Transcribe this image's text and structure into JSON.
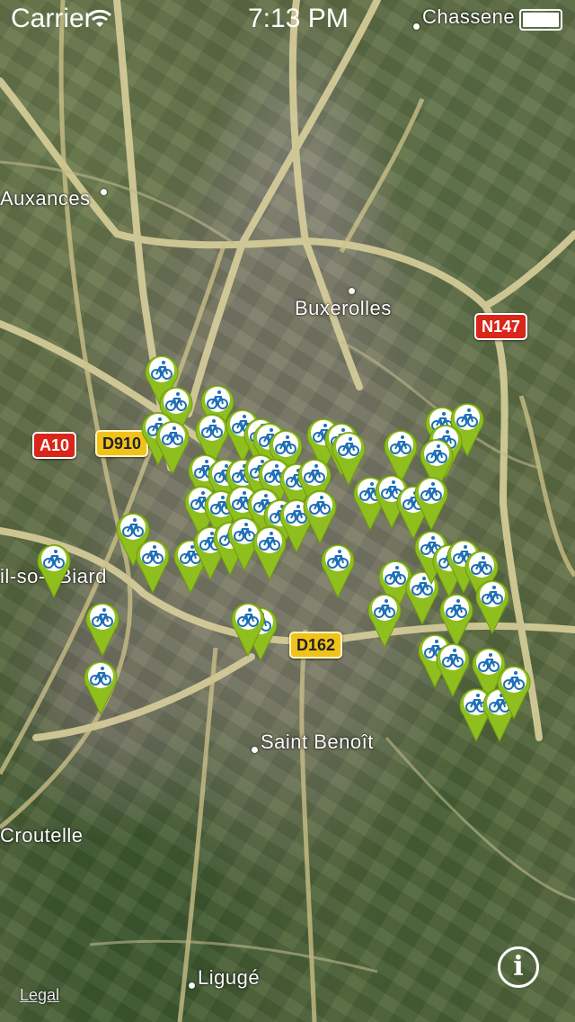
{
  "status_bar": {
    "carrier": "Carrier",
    "time": "7:13 PM"
  },
  "map": {
    "places": [
      {
        "id": "chasseneuil",
        "label": "Chassene"
      },
      {
        "id": "auxances",
        "label": "Auxances"
      },
      {
        "id": "buxerolles",
        "label": "Buxerolles"
      },
      {
        "id": "biard",
        "label": "il-so- -Biard"
      },
      {
        "id": "saint-benoit",
        "label": "Saint Benoît"
      },
      {
        "id": "croutelle",
        "label": "Croutelle"
      },
      {
        "id": "liguge",
        "label": "Ligugé"
      }
    ],
    "road_shields": [
      {
        "id": "a10",
        "label": "A10",
        "color": "#d9251a"
      },
      {
        "id": "d910",
        "label": "D910",
        "color": "#f0c21a"
      },
      {
        "id": "n147",
        "label": "N147",
        "color": "#d9251a"
      },
      {
        "id": "d162",
        "label": "D162",
        "color": "#f0c21a"
      }
    ],
    "pin_color": "#8fbf1e",
    "pin_icon_color": "#1f6fb5"
  },
  "legal_link": "Legal",
  "info_button": "i"
}
